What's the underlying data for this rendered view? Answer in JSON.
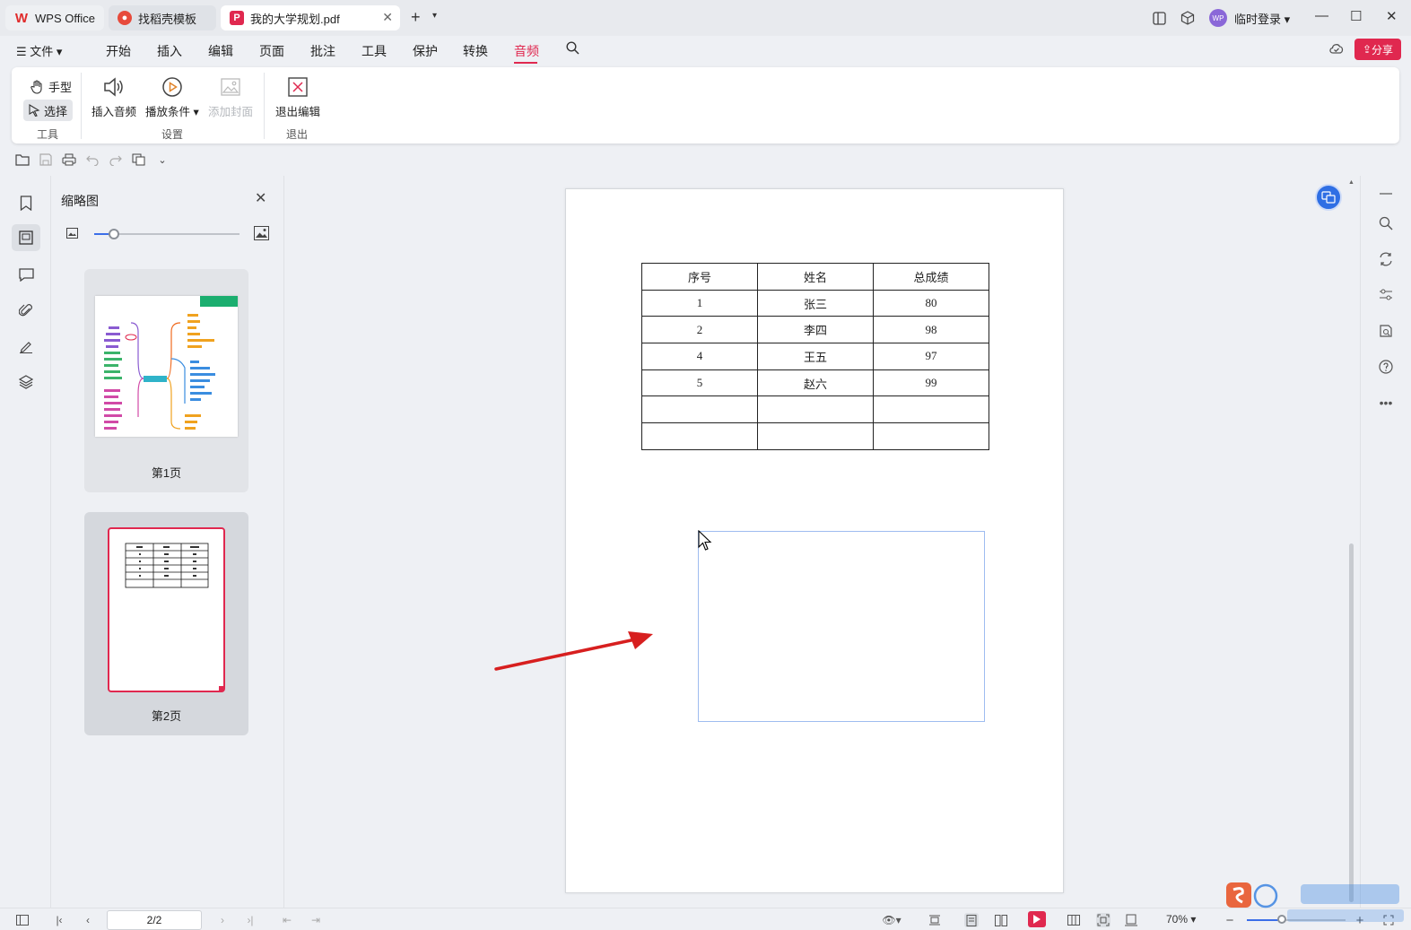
{
  "titlebar": {
    "tabs": [
      {
        "label": "WPS Office"
      },
      {
        "label": "找稻壳模板"
      },
      {
        "label": "我的大学规划.pdf"
      }
    ],
    "login_label": "临时登录",
    "avatar_text": "WP"
  },
  "menubar": {
    "file_label": "文件",
    "items": [
      "开始",
      "插入",
      "编辑",
      "页面",
      "批注",
      "工具",
      "保护",
      "转换",
      "音频"
    ],
    "active_item": "音频",
    "share_label": "分享",
    "accent_color": "#e0284f"
  },
  "ribbon": {
    "hand_label": "手型",
    "select_label": "选择",
    "tools_group_label": "工具",
    "insert_audio_label": "插入音频",
    "play_condition_label": "播放条件",
    "add_cover_label": "添加封面",
    "settings_group_label": "设置",
    "exit_edit_label": "退出编辑",
    "exit_group_label": "退出"
  },
  "thumbnails": {
    "title": "缩略图",
    "pages": [
      {
        "label": "第1页"
      },
      {
        "label": "第2页"
      }
    ],
    "selected_page": 2
  },
  "document": {
    "table": {
      "headers": [
        "序号",
        "姓名",
        "总成绩"
      ],
      "rows": [
        [
          "1",
          "张三",
          "80"
        ],
        [
          "2",
          "李四",
          "98"
        ],
        [
          "4",
          "王五",
          "97"
        ],
        [
          "5",
          "赵六",
          "99"
        ],
        [
          "",
          "",
          ""
        ],
        [
          "",
          "",
          ""
        ]
      ]
    }
  },
  "statusbar": {
    "page_indicator": "2/2",
    "zoom": "70%"
  },
  "icons": [
    "bookmark-icon",
    "thumbnail-icon",
    "comment-icon",
    "attachment-icon",
    "signature-icon",
    "layers-icon",
    "search-icon",
    "help-icon",
    "more-icon"
  ]
}
